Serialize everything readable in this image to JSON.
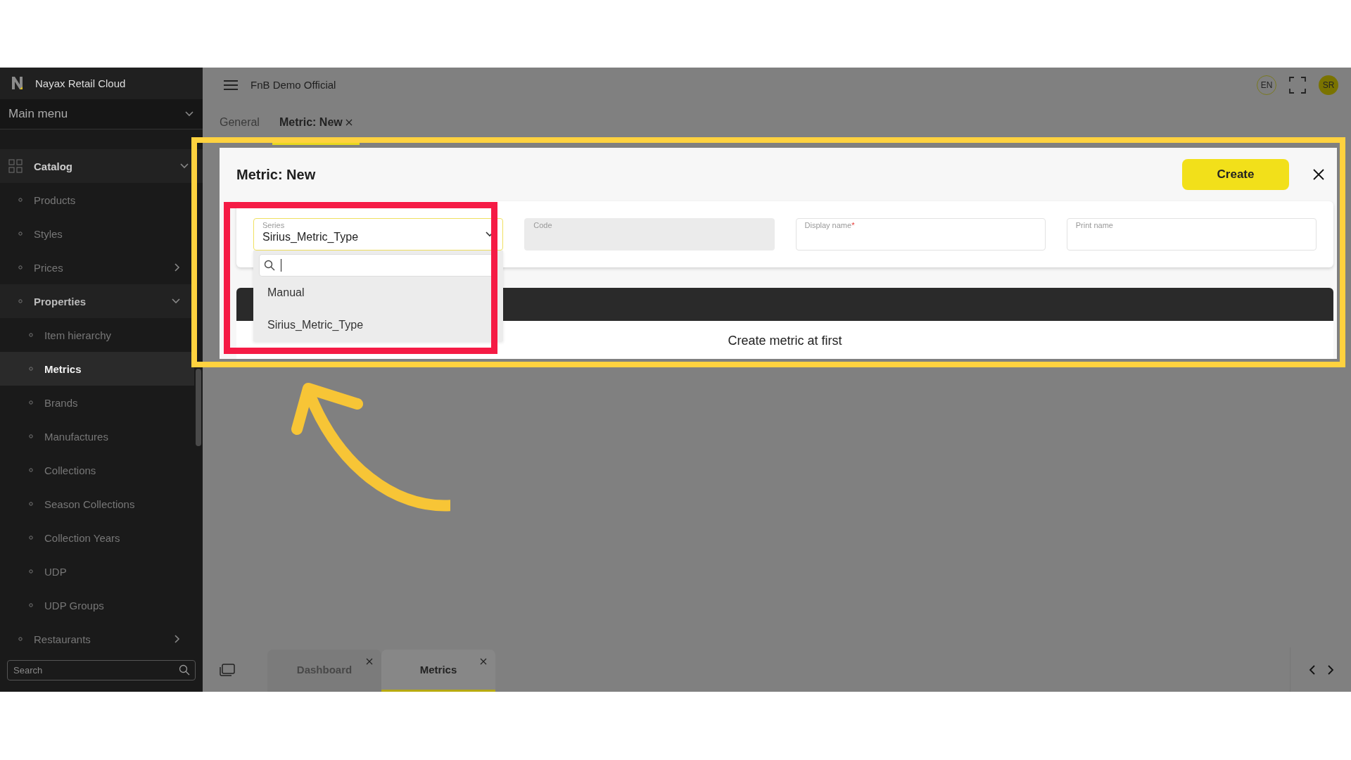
{
  "brand": {
    "name": "Nayax Retail Cloud"
  },
  "sidebar": {
    "menu_title": "Main menu",
    "search": {
      "placeholder": "Search"
    },
    "items": [
      {
        "label": "Catalog",
        "kind": "branch",
        "expanded": true,
        "children": [
          {
            "label": "Products",
            "kind": "leaf",
            "selected": false
          },
          {
            "label": "Styles",
            "kind": "leaf",
            "selected": false
          },
          {
            "label": "Prices",
            "kind": "branch",
            "expanded": false
          },
          {
            "label": "Properties",
            "kind": "branch",
            "expanded": true,
            "children": [
              {
                "label": "Item hierarchy",
                "kind": "leaf",
                "selected": false
              },
              {
                "label": "Metrics",
                "kind": "leaf",
                "selected": true
              },
              {
                "label": "Brands",
                "kind": "leaf",
                "selected": false
              },
              {
                "label": "Manufactures",
                "kind": "leaf",
                "selected": false
              },
              {
                "label": "Collections",
                "kind": "leaf",
                "selected": false
              },
              {
                "label": "Season Collections",
                "kind": "leaf",
                "selected": false
              },
              {
                "label": "Collection Years",
                "kind": "leaf",
                "selected": false
              },
              {
                "label": "UDP",
                "kind": "leaf",
                "selected": false
              },
              {
                "label": "UDP Groups",
                "kind": "leaf",
                "selected": false
              }
            ]
          },
          {
            "label": "Restaurants",
            "kind": "branch",
            "expanded": false
          }
        ]
      }
    ]
  },
  "header": {
    "workspace": "FnB Demo Official",
    "language": "EN",
    "user_initials": "SR"
  },
  "tabs": [
    {
      "label": "General",
      "selected": false,
      "closable": false
    },
    {
      "label": "Metric: New",
      "selected": true,
      "closable": true
    }
  ],
  "panel": {
    "title": "Metric: New",
    "create_button": "Create",
    "fields": [
      {
        "label": "Series",
        "kind": "select",
        "value": "Sirius_Metric_Type",
        "disabled": false,
        "focused": true
      },
      {
        "label": "Code",
        "kind": "text",
        "disabled": true,
        "focused": false
      },
      {
        "label": "Display name",
        "kind": "text",
        "required_mark": "*",
        "disabled": false,
        "focused": false
      },
      {
        "label": "Print name",
        "kind": "text",
        "disabled": false,
        "focused": false
      }
    ],
    "dropdown": {
      "options": [
        {
          "label": "Manual"
        },
        {
          "label": "Sirius_Metric_Type"
        }
      ]
    },
    "table": {
      "empty_message": "Create metric at first"
    }
  },
  "bottom_tabs": [
    {
      "label": "Dashboard",
      "selected": false
    },
    {
      "label": "Metrics",
      "selected": true
    }
  ]
}
